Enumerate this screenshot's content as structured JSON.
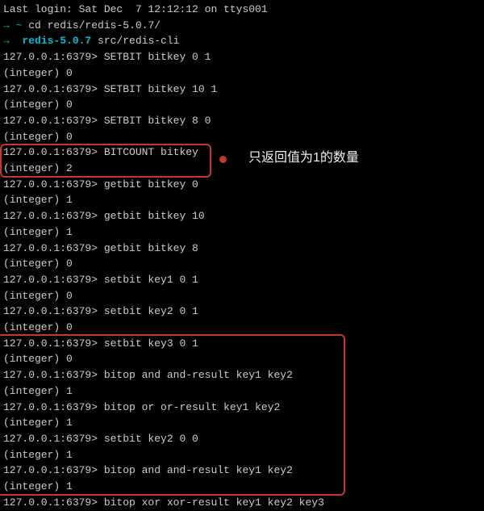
{
  "login_line": "Last login: Sat Dec  7 12:12:12 on ttys001",
  "cd_arrow": "→ ",
  "cd_tilde": "~",
  "cd_cmd": " cd redis/redis-5.0.7/",
  "dir_arrow": "→ ",
  "dir_name": " redis-5.0.7",
  "dir_cmd": " src/redis-cli",
  "p": "127.0.0.1:6379> ",
  "l": {
    "c1": "SETBIT bitkey 0 1",
    "r1": "(integer) 0",
    "c2": "SETBIT bitkey 10 1",
    "r2": "(integer) 0",
    "c3": "SETBIT bitkey 8 0",
    "r3": "(integer) 0",
    "c4": "BITCOUNT bitkey",
    "r4": "(integer) 2",
    "c5": "getbit bitkey 0",
    "r5": "(integer) 1",
    "c6": "getbit bitkey 10",
    "r6": "(integer) 1",
    "c7": "getbit bitkey 8",
    "r7": "(integer) 0",
    "c8": "setbit key1 0 1",
    "r8": "(integer) 0",
    "c9": "setbit key2 0 1",
    "r9": "(integer) 0",
    "c10": "setbit key3 0 1",
    "r10": "(integer) 0",
    "c11": "bitop and and-result key1 key2",
    "r11": "(integer) 1",
    "c12": "bitop or or-result key1 key2",
    "r12": "(integer) 1",
    "c13": "setbit key2 0 0",
    "r13": "(integer) 1",
    "c14": "bitop and and-result key1 key2",
    "r14": "(integer) 1",
    "c15": "bitop xor xor-result key1 key2 key3"
  },
  "annotation_text": "只返回值为1的数量"
}
